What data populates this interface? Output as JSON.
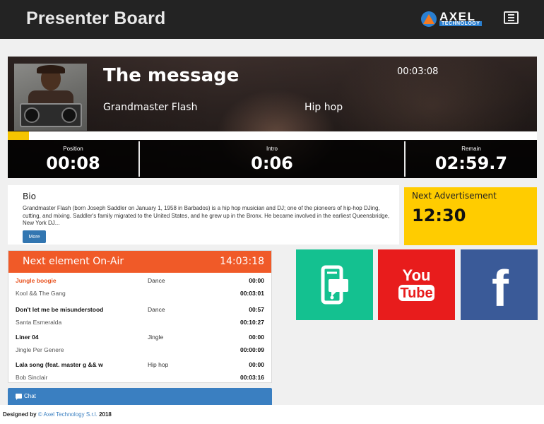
{
  "header": {
    "title": "Presenter Board",
    "logo_text": "AXEL",
    "logo_sub": "TECHNOLOGY"
  },
  "now_playing": {
    "title": "The message",
    "artist": "Grandmaster Flash",
    "genre": "Hip hop",
    "duration": "00:03:08",
    "progress_fraction": 0.04,
    "position_label": "Position",
    "position": "00:08",
    "intro_label": "Intro",
    "intro": "0:06",
    "remain_label": "Remain",
    "remain": "02:59.7"
  },
  "bio": {
    "heading": "Bio",
    "text": "Grandmaster Flash (born Joseph Saddler on January 1, 1958 in Barbados) is a hip hop musician and DJ; one of the pioneers of hip-hop DJing, cutting, and mixing. Saddler's family migrated to the United States, and he grew up in the Bronx. He became involved in the earliest Queensbridge, New York DJ...",
    "more_label": "More"
  },
  "advertisement": {
    "heading": "Next Advertisement",
    "time": "12:30"
  },
  "on_air": {
    "heading": "Next element On-Air",
    "clock": "14:03:18",
    "items": [
      {
        "title": "Jungle boogie",
        "artist": "Kool && The Gang",
        "genre": "Dance",
        "duration": "00:00",
        "start": "00:03:01",
        "active": true
      },
      {
        "title": "Don't let me be misunderstood",
        "artist": "Santa Esmeralda",
        "genre": "Dance",
        "duration": "00:57",
        "start": "00:10:27",
        "active": false
      },
      {
        "title": "Liner 04",
        "artist": "Jingle Per Genere",
        "genre": "Jingle",
        "duration": "00:00",
        "start": "00:00:09",
        "active": false
      },
      {
        "title": "Lala song (feat. master g && w",
        "artist": "Bob Sinclair",
        "genre": "Hip hop",
        "duration": "00:00",
        "start": "00:03:16",
        "active": false
      }
    ]
  },
  "chat": {
    "label": "Chat"
  },
  "social": {
    "app_icon": "mobile-chat-icon",
    "youtube_icon": "youtube-icon",
    "youtube_text_1": "You",
    "youtube_text_2": "Tube",
    "facebook_icon": "facebook-icon",
    "facebook_text": "f"
  },
  "footer": {
    "prefix": "Designed by",
    "company": "© Axel Technology S.r.l.",
    "year": "2018"
  },
  "colors": {
    "header": "#232323",
    "accent_orange": "#f05a28",
    "ad_yellow": "#ffcc00",
    "progress": "#f5c400",
    "button_blue": "#3276b1",
    "app_green": "#14c190",
    "youtube_red": "#e81c1c",
    "facebook_blue": "#3a5a98"
  }
}
